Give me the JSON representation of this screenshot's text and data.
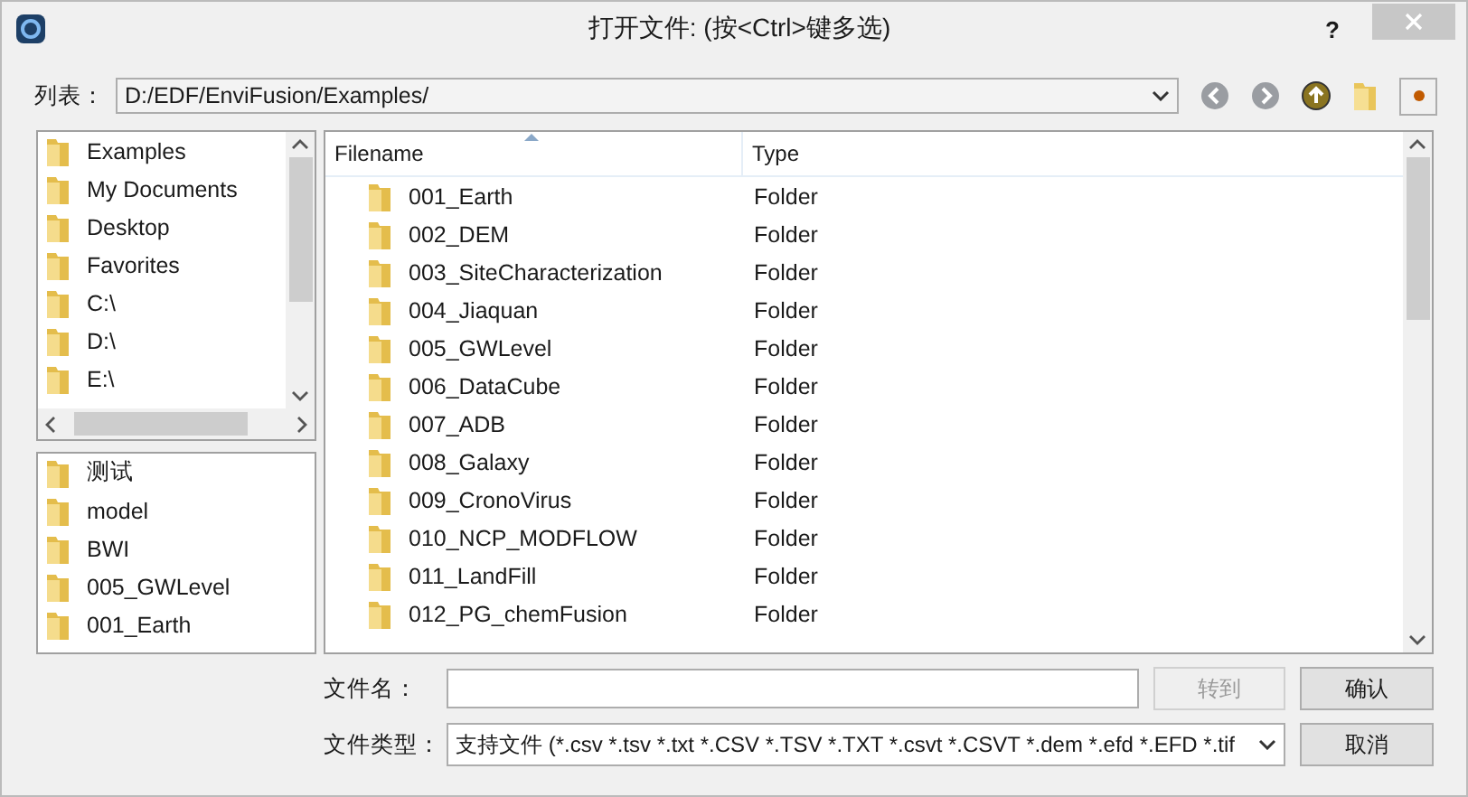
{
  "window": {
    "title": "打开文件: (按<Ctrl>键多选)",
    "help": "?"
  },
  "location": {
    "label": "列表：",
    "value": "D:/EDF/EnviFusion/Examples/"
  },
  "places": [
    "Examples",
    "My Documents",
    "Desktop",
    "Favorites",
    "C:\\",
    "D:\\",
    "E:\\"
  ],
  "history": [
    "测试",
    "model",
    "BWI",
    "005_GWLevel",
    "001_Earth"
  ],
  "table": {
    "columns": [
      "Filename",
      "Type"
    ],
    "rows": [
      {
        "name": "001_Earth",
        "type": "Folder"
      },
      {
        "name": "002_DEM",
        "type": "Folder"
      },
      {
        "name": "003_SiteCharacterization",
        "type": "Folder"
      },
      {
        "name": "004_Jiaquan",
        "type": "Folder"
      },
      {
        "name": "005_GWLevel",
        "type": "Folder"
      },
      {
        "name": "006_DataCube",
        "type": "Folder"
      },
      {
        "name": "007_ADB",
        "type": "Folder"
      },
      {
        "name": "008_Galaxy",
        "type": "Folder"
      },
      {
        "name": "009_CronoVirus",
        "type": "Folder"
      },
      {
        "name": "010_NCP_MODFLOW",
        "type": "Folder"
      },
      {
        "name": "011_LandFill",
        "type": "Folder"
      },
      {
        "name": "012_PG_chemFusion",
        "type": "Folder"
      }
    ]
  },
  "filename": {
    "label": "文件名："
  },
  "filetype": {
    "label": "文件类型：",
    "value": "支持文件 (*.csv *.tsv *.txt *.CSV *.TSV *.TXT *.csvt *.CSVT *.dem *.efd *.EFD *.tif"
  },
  "buttons": [
    {
      "label": "转到",
      "disabled": true
    },
    {
      "label": "确认",
      "disabled": false
    },
    {
      "label": "取消",
      "disabled": false
    }
  ]
}
